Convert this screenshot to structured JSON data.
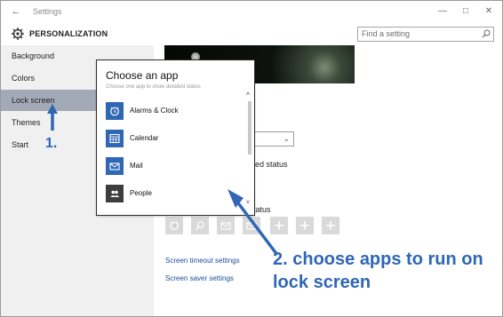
{
  "window": {
    "back_icon": "back-arrow-icon",
    "title": "Settings",
    "minimize_icon": "minimize-icon",
    "maximize_icon": "maximize-icon",
    "close_icon": "close-icon"
  },
  "header": {
    "icon": "gear-icon",
    "title": "PERSONALIZATION",
    "search_placeholder": "Find a setting",
    "search_icon": "search-icon"
  },
  "sidebar": {
    "items": [
      {
        "label": "Background",
        "active": false
      },
      {
        "label": "Colors",
        "active": false
      },
      {
        "label": "Lock screen",
        "active": true
      },
      {
        "label": "Themes",
        "active": false
      },
      {
        "label": "Start",
        "active": false
      }
    ]
  },
  "main": {
    "detailed_status_fragment": "led status",
    "quick_status_fragment": "tatus",
    "links": [
      "Screen timeout settings",
      "Screen saver settings"
    ],
    "tile_icons": [
      "alarm-clock-icon",
      "search-icon",
      "mail-icon",
      "mail-icon",
      "plus-icon",
      "plus-icon",
      "plus-icon"
    ]
  },
  "modal": {
    "title": "Choose an app",
    "cut_text": "Choose one app to show detailed status",
    "apps": [
      {
        "label": "Alarms & Clock",
        "icon": "alarm-clock-icon"
      },
      {
        "label": "Calendar",
        "icon": "calendar-icon"
      },
      {
        "label": "Mail",
        "icon": "mail-icon"
      },
      {
        "label": "People",
        "icon": "people-icon"
      }
    ]
  },
  "annotations": {
    "step1": "1.",
    "step2_line1": "2. choose apps to run on",
    "step2_line2": "lock screen",
    "accent_color": "#2f67b5"
  }
}
